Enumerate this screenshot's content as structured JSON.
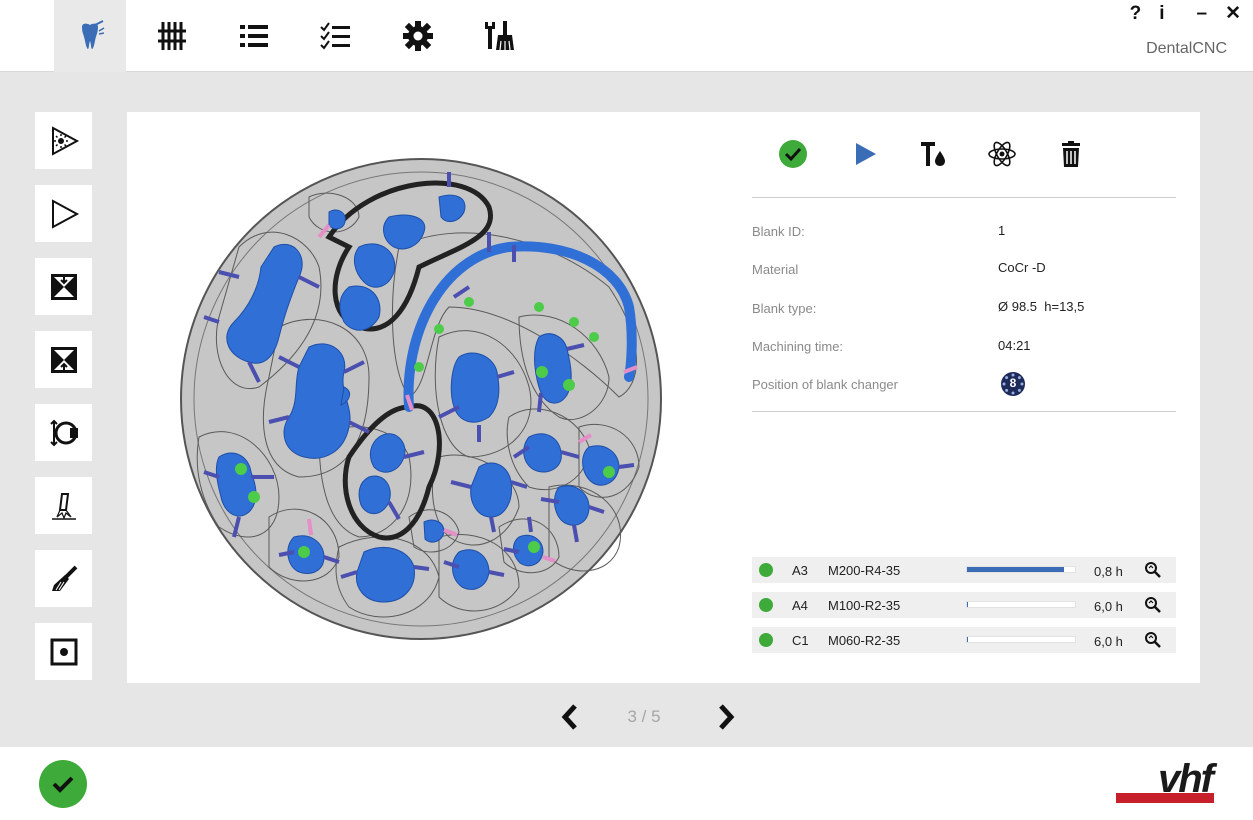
{
  "window": {
    "app_title": "DentalCNC",
    "help_label": "?",
    "info_label": "i",
    "minimize_label": "–",
    "close_label": "✕"
  },
  "top_nav": {
    "tabs": [
      {
        "id": "tab-tooth",
        "icon": "tooth-icon",
        "active": true
      },
      {
        "id": "tab-adjust",
        "icon": "sliders-icon",
        "active": false
      },
      {
        "id": "tab-list",
        "icon": "list-icon",
        "active": false
      },
      {
        "id": "tab-checklist",
        "icon": "checklist-icon",
        "active": false
      },
      {
        "id": "tab-settings",
        "icon": "gear-icon",
        "active": false
      },
      {
        "id": "tab-service",
        "icon": "tools-brush-icon",
        "active": false
      }
    ]
  },
  "sidebar": {
    "items": [
      {
        "icon": "scan-play-icon"
      },
      {
        "icon": "play-outline-icon"
      },
      {
        "icon": "clamp-open-icon"
      },
      {
        "icon": "clamp-close-icon"
      },
      {
        "icon": "rotate-blank-icon"
      },
      {
        "icon": "spray-tool-icon"
      },
      {
        "icon": "brush-icon"
      },
      {
        "icon": "target-square-icon"
      }
    ]
  },
  "actions": {
    "icons": [
      "check-circle-icon",
      "play-icon",
      "tool-coolant-icon",
      "atom-icon",
      "trash-icon"
    ],
    "colors": {
      "green": "#3daa3a",
      "blue": "#3a6db5"
    }
  },
  "blank_info": {
    "rows": [
      {
        "label": "Blank ID:",
        "value": "1"
      },
      {
        "label": "Material",
        "value": "CoCr -D"
      },
      {
        "label": "Blank type:",
        "value": "Ø 98.5  h=13,5"
      },
      {
        "label": "Machining time:",
        "value": "04:21"
      },
      {
        "label": "Position of blank changer",
        "value": "8"
      }
    ]
  },
  "tools": [
    {
      "position": "A3",
      "name": "M200-R4-35",
      "usage_fraction": 0.9,
      "hours": "0,8 h",
      "status_color": "#3daa3a"
    },
    {
      "position": "A4",
      "name": "M100-R2-35",
      "usage_fraction": 0.01,
      "hours": "6,0 h",
      "status_color": "#3daa3a"
    },
    {
      "position": "C1",
      "name": "M060-R2-35",
      "usage_fraction": 0.01,
      "hours": "6,0 h",
      "status_color": "#3daa3a"
    }
  ],
  "pager": {
    "text": "3 / 5"
  },
  "brand": {
    "logo_text": "vhf",
    "accent": "#c8202a"
  }
}
